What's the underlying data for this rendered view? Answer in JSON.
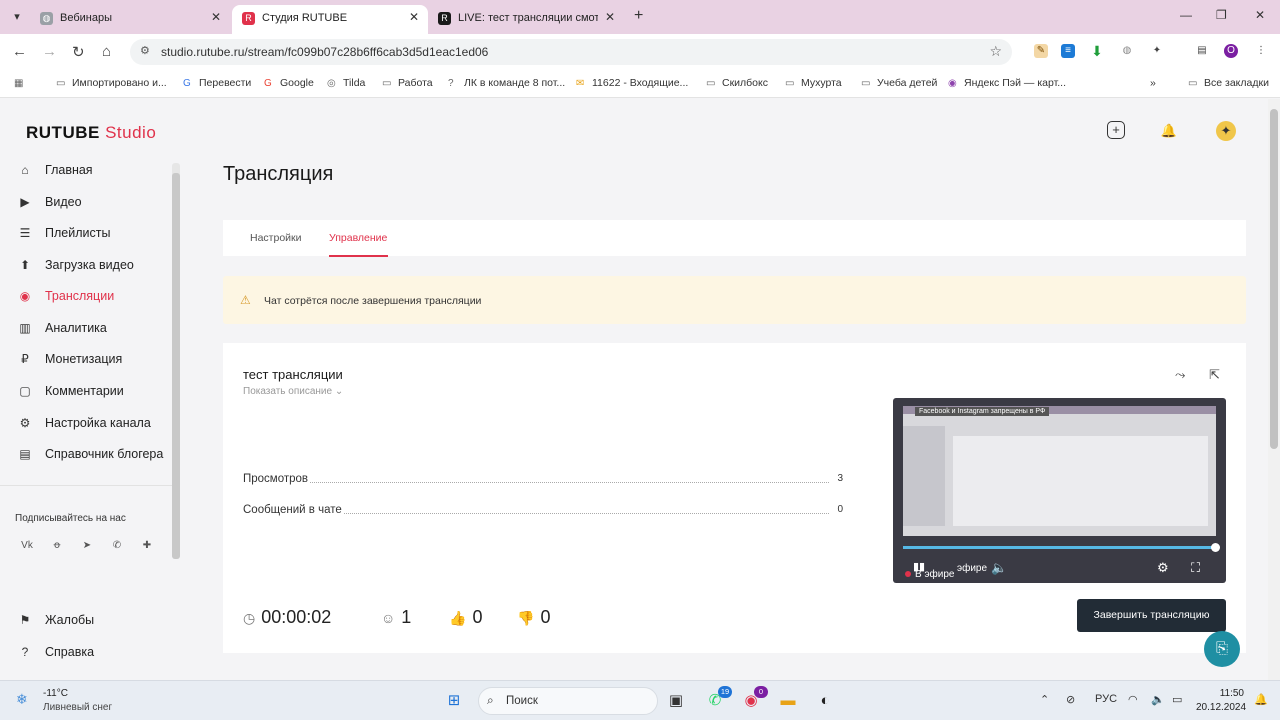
{
  "browser": {
    "tabs": [
      {
        "title": "Вебинары",
        "favicon_color": "#9aa0a6",
        "active": false
      },
      {
        "title": "Студия RUTUBE",
        "favicon_color": "#e0324b",
        "active": true
      },
      {
        "title": "LIVE: тест трансляции смотреть",
        "favicon_color": "#1a1a1a",
        "active": false
      }
    ],
    "url": "studio.rutube.ru/stream/fc099b07c28b6ff6cab3d5d1eac1ed06",
    "bookmarks": [
      "Импортировано и...",
      "Перевести",
      "Google",
      "Tilda",
      "Работа",
      "ЛК в команде 8 пот...",
      "11622 - Входящие...",
      "Скилбокс",
      "Мухурта",
      "Учеба детей",
      "Яндекс Пэй — карт..."
    ],
    "all_bookmarks": "Все закладки",
    "profile_letter": "О"
  },
  "app": {
    "logo_main": "RUTUBE",
    "logo_studio": "Studio",
    "accent": "#e0324b",
    "nav": [
      {
        "label": "Главная",
        "icon": "home-icon"
      },
      {
        "label": "Видео",
        "icon": "video-icon"
      },
      {
        "label": "Плейлисты",
        "icon": "playlist-icon"
      },
      {
        "label": "Загрузка видео",
        "icon": "upload-icon"
      },
      {
        "label": "Трансляции",
        "icon": "broadcast-icon"
      },
      {
        "label": "Аналитика",
        "icon": "analytics-icon"
      },
      {
        "label": "Монетизация",
        "icon": "monetization-icon"
      },
      {
        "label": "Комментарии",
        "icon": "comments-icon"
      },
      {
        "label": "Настройка канала",
        "icon": "settings-icon"
      },
      {
        "label": "Справочник блогера",
        "icon": "handbook-icon"
      }
    ],
    "active_nav": "Трансляции",
    "subscribe_label": "Подписывайтесь на нас",
    "socials": [
      "vk-icon",
      "ok-icon",
      "telegram-icon",
      "viber-icon",
      "plus-icon"
    ],
    "bottom_nav": [
      {
        "label": "Жалобы",
        "icon": "complaints-icon"
      },
      {
        "label": "Справка",
        "icon": "help-icon"
      }
    ]
  },
  "main": {
    "title": "Трансляция",
    "tabs": [
      {
        "label": "Настройки",
        "active": false
      },
      {
        "label": "Управление",
        "active": true
      }
    ],
    "warning": "Чат сотрётся после завершения трансляции",
    "stream": {
      "title": "тест трансляции",
      "show_description": "Показать описание",
      "stats": [
        {
          "label": "Просмотров",
          "value": "3"
        },
        {
          "label": "Сообщений в чате",
          "value": "0"
        }
      ],
      "player": {
        "overlay_banner": "Facebook и Instagram запрещены в РФ",
        "live_label": "В эфире",
        "live_label_ghost": "эфире",
        "progress": 1.0
      },
      "duration": "00:00:02",
      "viewers": "1",
      "likes": "0",
      "dislikes": "0",
      "end_button": "Завершить трансляцию"
    }
  },
  "taskbar": {
    "temperature": "-11°C",
    "weather": "Ливневый снег",
    "search_label": "Поиск",
    "whatsapp_badge": "19",
    "chrome_badge": "0",
    "language": "РУС",
    "time": "11:50",
    "date": "20.12.2024"
  }
}
